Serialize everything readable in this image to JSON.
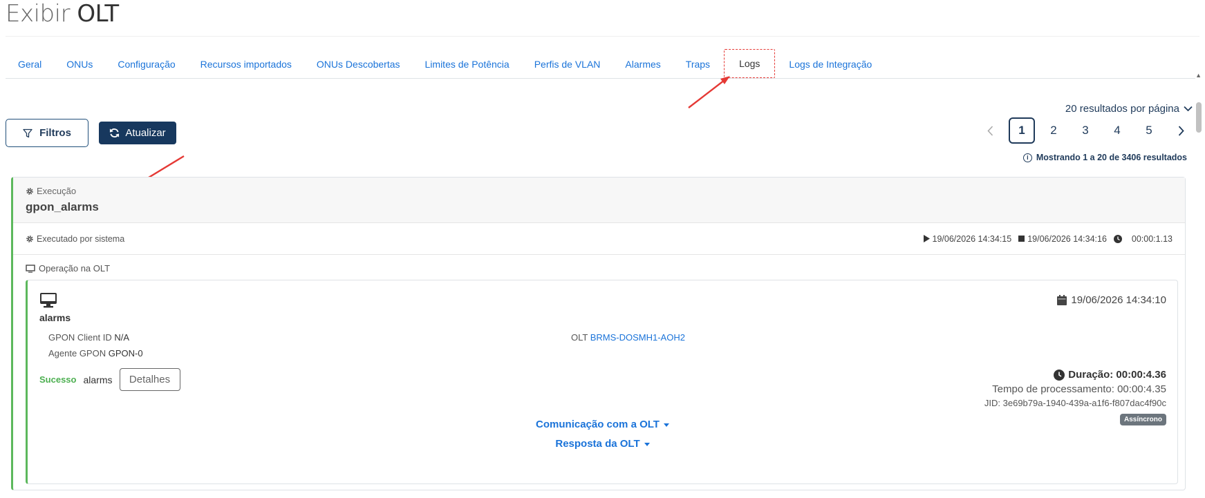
{
  "page": {
    "title_light": "Exibir ",
    "title_bold": "OLT"
  },
  "tabs": [
    {
      "label": "Geral"
    },
    {
      "label": "ONUs"
    },
    {
      "label": "Configuração"
    },
    {
      "label": "Recursos importados"
    },
    {
      "label": "ONUs Descobertas"
    },
    {
      "label": "Limites de Potência"
    },
    {
      "label": "Perfis de VLAN"
    },
    {
      "label": "Alarmes"
    },
    {
      "label": "Traps"
    },
    {
      "label": "Logs",
      "active": true
    },
    {
      "label": "Logs de Integração"
    }
  ],
  "toolbar": {
    "filters_label": "Filtros",
    "refresh_label": "Atualizar"
  },
  "pagination": {
    "per_page_label": "20 resultados por página",
    "pages": [
      "1",
      "2",
      "3",
      "4",
      "5"
    ],
    "current": "1",
    "results_info": "Mostrando 1 a 20 de 3406 resultados"
  },
  "execution": {
    "label": "Execução",
    "name": "gpon_alarms",
    "executed_by": "Executado por sistema",
    "start": "19/06/2026 14:34:15",
    "end": "19/06/2026 14:34:16",
    "elapsed": "00:00:1.13",
    "operation_section_label": "Operação na OLT"
  },
  "operation": {
    "name": "alarms",
    "date": "19/06/2026 14:34:10",
    "gpon_client_label": "GPON Client ID",
    "gpon_client_value": "N/A",
    "agent_label": "Agente GPON",
    "agent_value": "GPON-0",
    "olt_label": "OLT",
    "olt_value": "BRMS-DOSMH1-AOH2",
    "status": "Sucesso",
    "status_name": "alarms",
    "details_label": "Detalhes",
    "duration": "Duração: 00:00:4.36",
    "processing_time": "Tempo de processamento: 00:00:4.35",
    "jid": "JID: 3e69b79a-1940-439a-a1f6-f807dac4f90c",
    "mode_badge": "Assíncrono",
    "comm_toggle": "Comunicação com a OLT",
    "response_toggle": "Resposta da OLT"
  },
  "colors": {
    "accent": "#1a73d9",
    "navy": "#17385e",
    "success": "#5cb85c",
    "annotation": "#e53935"
  }
}
